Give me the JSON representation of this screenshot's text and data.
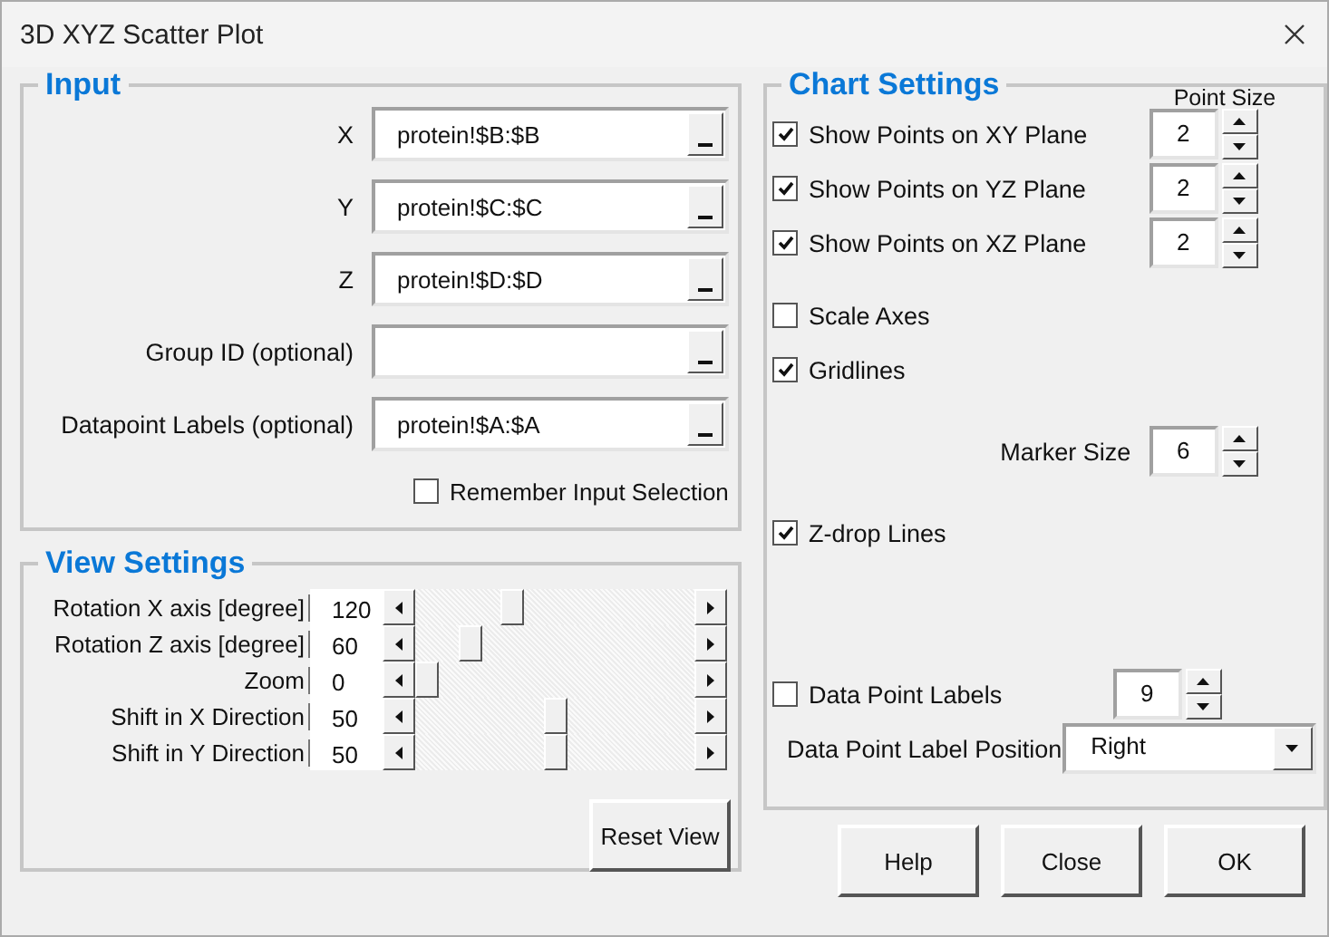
{
  "window": {
    "title": "3D XYZ Scatter Plot"
  },
  "input": {
    "title": "Input",
    "fields": [
      {
        "label": "X",
        "value": "protein!$B:$B"
      },
      {
        "label": "Y",
        "value": "protein!$C:$C"
      },
      {
        "label": "Z",
        "value": "protein!$D:$D"
      },
      {
        "label": "Group ID (optional)"
      },
      {
        "label": "Datapoint Labels (optional)",
        "value": "protein!$A:$A"
      }
    ],
    "remember": {
      "label": "Remember Input Selection",
      "checked": false
    }
  },
  "view_settings": {
    "title": "View Settings",
    "sliders": [
      {
        "label": "Rotation X axis [degree]",
        "value": "120",
        "level": 0.33
      },
      {
        "label": "Rotation Z axis [degree]",
        "value": "60",
        "level": 0.17
      },
      {
        "label": "Zoom",
        "value": "0",
        "level": 0
      },
      {
        "label": "Shift in X Direction",
        "value": "50",
        "level": 0.5
      },
      {
        "label": "Shift in Y Direction",
        "value": "50",
        "level": 0.5
      }
    ],
    "reset_button": "Reset View"
  },
  "chart_settings": {
    "title": "Chart Settings",
    "point_size_header": "Point Size",
    "items": [
      {
        "kind": "check_spin",
        "label": "Show Points on XY Plane",
        "checked": true,
        "value": "2"
      },
      {
        "kind": "check_spin",
        "label": "Show Points on YZ Plane",
        "checked": true,
        "value": "2"
      },
      {
        "kind": "check_spin",
        "label": "Show Points on XZ Plane",
        "checked": true,
        "value": "2"
      },
      {
        "kind": "check",
        "label": "Scale Axes",
        "checked": false
      },
      {
        "kind": "check",
        "label": "Gridlines",
        "checked": true
      },
      {
        "kind": "spin",
        "label": "Marker Size",
        "value": "6"
      },
      {
        "kind": "check",
        "label": "Z-drop Lines",
        "checked": true
      },
      {
        "kind": "check_spin",
        "label": "Data Point Labels",
        "checked": false,
        "value": "9"
      },
      {
        "kind": "select",
        "label": "Data Point Label Position",
        "value": "Right"
      }
    ]
  },
  "buttons": [
    "Help",
    "Close",
    "OK"
  ]
}
